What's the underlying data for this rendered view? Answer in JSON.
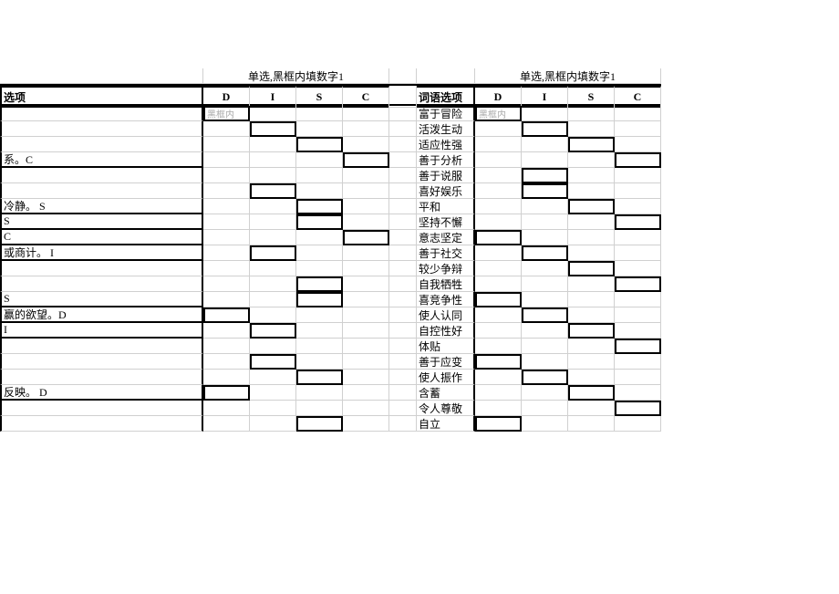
{
  "titles": {
    "left": "单选,黑框内填数字1",
    "right": "单选,黑框内填数字1"
  },
  "headers": {
    "left_option": "选项",
    "right_option": "词语选项",
    "D": "D",
    "I": "I",
    "S": "S",
    "C": "C",
    "placeholder": "黑框内"
  },
  "left_rows": [
    {
      "label": "",
      "box": 0
    },
    {
      "label": "",
      "box": 1
    },
    {
      "label": "",
      "box": 2
    },
    {
      "label": "系。C",
      "box": 3
    },
    {
      "label": "",
      "box": null
    },
    {
      "label": "",
      "box": 1
    },
    {
      "label": "冷静。 S",
      "box": 2
    },
    {
      "label": " S",
      "box": 2
    },
    {
      "label": " C",
      "box": 3
    },
    {
      "label": "或商计。 I",
      "box": 1
    },
    {
      "label": "",
      "box": null
    },
    {
      "label": "",
      "box": 2
    },
    {
      "label": "S",
      "box": 2
    },
    {
      "label": "赢的欲望。D",
      "box": 0
    },
    {
      "label": "I",
      "box": 1
    },
    {
      "label": "",
      "box": null
    },
    {
      "label": "",
      "box": 1
    },
    {
      "label": "",
      "box": 2
    },
    {
      "label": "反映。 D",
      "box": 0
    },
    {
      "label": "",
      "box": null
    },
    {
      "label": "",
      "box": 2
    }
  ],
  "right_rows": [
    {
      "label": "富于冒险",
      "box": 0
    },
    {
      "label": "活泼生动",
      "box": 1
    },
    {
      "label": "适应性强",
      "box": 2
    },
    {
      "label": "善于分析",
      "box": 3
    },
    {
      "label": "善于说服",
      "box": 1
    },
    {
      "label": "喜好娱乐",
      "box": 1
    },
    {
      "label": "平和",
      "box": 2
    },
    {
      "label": "坚持不懈",
      "box": 3
    },
    {
      "label": "意志坚定",
      "box": 0
    },
    {
      "label": "善于社交",
      "box": 1
    },
    {
      "label": "较少争辩",
      "box": 2
    },
    {
      "label": "自我牺牲",
      "box": 3
    },
    {
      "label": "喜竞争性",
      "box": 0
    },
    {
      "label": "使人认同",
      "box": 1
    },
    {
      "label": "自控性好",
      "box": 2
    },
    {
      "label": "体贴",
      "box": 3
    },
    {
      "label": "善于应变",
      "box": 0
    },
    {
      "label": "使人振作",
      "box": 1
    },
    {
      "label": "含蓄",
      "box": 2
    },
    {
      "label": "令人尊敬",
      "box": 3
    },
    {
      "label": "自立",
      "box": 0
    }
  ]
}
